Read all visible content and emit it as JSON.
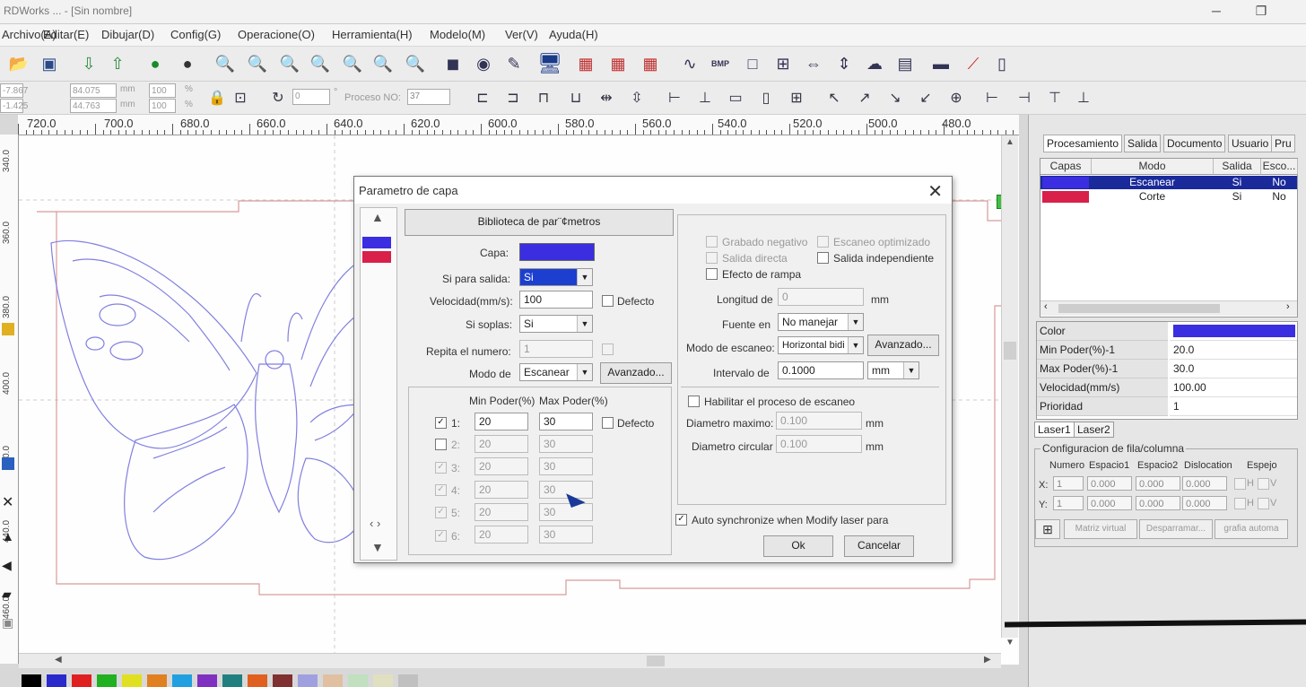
{
  "window": {
    "title": "RDWorks ... - [Sin nombre]"
  },
  "menu": [
    "Archivo(A)",
    "Editar(E)",
    "Dibujar(D)",
    "Config(G)",
    "Operacione(O)",
    "Herramienta(H)",
    "Modelo(M)",
    "Ver(V)",
    "Ayuda(H)"
  ],
  "toolbar2": {
    "x_val": "-7.867",
    "y_val": "-1.425",
    "w_val": "84.075",
    "h_val": "44.763",
    "mm": "mm",
    "pct1": "100",
    "pct2": "100",
    "pct": "%",
    "rotate_val": "0",
    "degree": "°",
    "proceso_label": "Proceso NO:",
    "proceso_val": "37"
  },
  "ruler": {
    "labels": [
      "720.0",
      "700.0",
      "680.0",
      "660.0",
      "640.0",
      "620.0",
      "600.0",
      "580.0",
      "560.0",
      "540.0",
      "520.0",
      "500.0",
      "480.0"
    ]
  },
  "vruler": {
    "labels": [
      "340.0",
      "360.0",
      "380.0",
      "400.0",
      "420.0",
      "440.0",
      "460.0"
    ]
  },
  "dialog": {
    "title": "Parametro de capa",
    "library_button": "Biblioteca de par¨¢metros",
    "capa_label": "Capa:",
    "capa_color": "#3a2ee0",
    "salida_label": "Si para salida:",
    "salida_value": "Si",
    "velocidad_label": "Velocidad(mm/s):",
    "velocidad_value": "100",
    "defecto_label": "Defecto",
    "soplas_label": "Si soplas:",
    "soplas_value": "Si",
    "repita_label": "Repita el numero:",
    "repita_value": "1",
    "modo_label": "Modo de",
    "modo_value": "Escanear",
    "avanzado_label": "Avanzado...",
    "min_poder_header": "Min Poder(%)",
    "max_poder_header": "Max Poder(%)",
    "defecto2_label": "Defecto",
    "power_rows": [
      {
        "num": "1:",
        "min": "20",
        "max": "30",
        "checked": "✓"
      },
      {
        "num": "2:",
        "min": "20",
        "max": "30",
        "checked": ""
      },
      {
        "num": "3:",
        "min": "20",
        "max": "30",
        "checked": "✓"
      },
      {
        "num": "4:",
        "min": "20",
        "max": "30",
        "checked": "✓"
      },
      {
        "num": "5:",
        "min": "20",
        "max": "30",
        "checked": "✓"
      },
      {
        "num": "6:",
        "min": "20",
        "max": "30",
        "checked": "✓"
      }
    ],
    "grabado_label": "Grabado negativo",
    "escaneo_opt_label": "Escaneo optimizado",
    "salida_directa_label": "Salida directa",
    "salida_indep_label": "Salida independiente",
    "rampa_label": "Efecto de rampa",
    "longitud_label": "Longitud de",
    "longitud_value": "0",
    "fuente_label": "Fuente en",
    "fuente_value": "No manejar",
    "modo_escaneo_label": "Modo de escaneo:",
    "modo_escaneo_value": "Horizontal bidi",
    "avanzado2_label": "Avanzado...",
    "intervalo_label": "Intervalo de",
    "intervalo_value": "0.1000",
    "intervalo_unit": "mm",
    "mm": "mm",
    "habilitar_label": "Habilitar el proceso de escaneo",
    "diam_max_label": "Diametro maximo:",
    "diam_max_value": "0.100",
    "diam_circ_label": "Diametro circular",
    "diam_circ_value": "0.100",
    "autosync_label": "Auto synchronize when Modify laser para",
    "ok_label": "Ok",
    "cancel_label": "Cancelar"
  },
  "right_panel": {
    "tabs": [
      "Procesamiento",
      "Salida",
      "Documento",
      "Usuario",
      "Pru"
    ],
    "layer_headers": [
      "Capas",
      "Modo",
      "Salida",
      "Esco..."
    ],
    "layers": [
      {
        "color": "#3a2ee0",
        "modo": "Escanear",
        "salida": "Si",
        "esco": "No"
      },
      {
        "color": "#d8204a",
        "modo": "Corte",
        "salida": "Si",
        "esco": "No"
      }
    ],
    "props": [
      {
        "name": "Color",
        "value": ""
      },
      {
        "name": "Min Poder(%)-1",
        "value": "20.0"
      },
      {
        "name": "Max Poder(%)-1",
        "value": "30.0"
      },
      {
        "name": "Velocidad(mm/s)",
        "value": "100.00"
      },
      {
        "name": "Prioridad",
        "value": "1"
      }
    ],
    "prop_color": "#3a2ee0",
    "laser_tabs": [
      "Laser1",
      "Laser2"
    ],
    "rowcol": {
      "title": "Configuracion de fila/columna",
      "headers": [
        "Numero",
        "Espacio1",
        "Espacio2",
        "Dislocation",
        "Espejo"
      ],
      "x_label": "X:",
      "y_label": "Y:",
      "x_vals": [
        "1",
        "0.000",
        "0.000",
        "0.000"
      ],
      "y_vals": [
        "1",
        "0.000",
        "0.000",
        "0.000"
      ],
      "h": "H",
      "v": "V",
      "buttons": [
        "Matriz virtual",
        "Desparramar...",
        "grafia automa"
      ]
    }
  },
  "palette_colors": [
    "#000000",
    "#2a2acc",
    "#e02020",
    "#20b020",
    "#e0e020",
    "#e08020",
    "#20a0e0",
    "#8030c0",
    "#208080",
    "#e06020",
    "#803030",
    "#a0a0e0",
    "#e0c0a0",
    "#c0e0c0",
    "#e0e0c0",
    "#c0c0c0"
  ]
}
